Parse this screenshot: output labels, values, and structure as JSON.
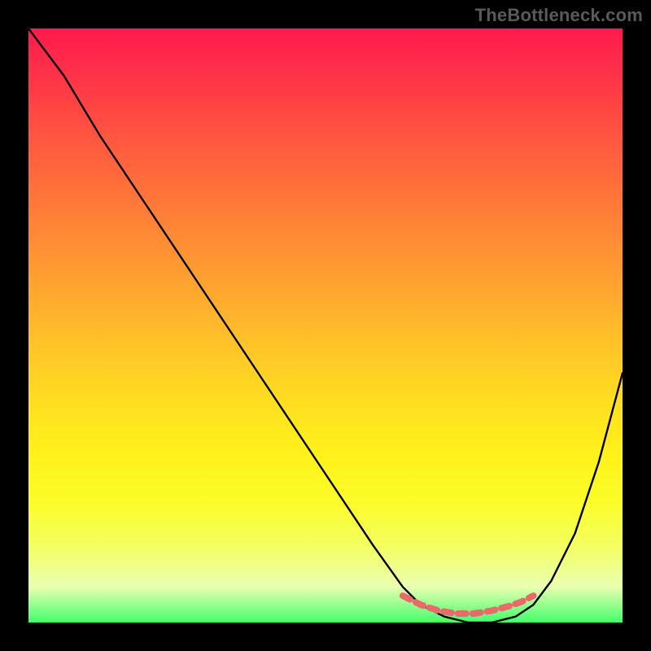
{
  "watermark": "TheBottleneck.com",
  "chart_data": {
    "type": "line",
    "title": "",
    "xlabel": "",
    "ylabel": "",
    "xlim": [
      0,
      100
    ],
    "ylim": [
      0,
      100
    ],
    "series": [
      {
        "name": "bottleneck-curve",
        "x": [
          0,
          6,
          12,
          20,
          30,
          40,
          50,
          58,
          63,
          66,
          70,
          74,
          78,
          82,
          85,
          88,
          92,
          96,
          100
        ],
        "values": [
          100,
          92,
          82,
          70,
          55,
          40,
          25,
          13,
          6,
          3,
          1,
          0,
          0,
          1,
          3,
          7,
          15,
          27,
          42
        ]
      },
      {
        "name": "optimal-red-band",
        "x": [
          63,
          66,
          69,
          72,
          75,
          78,
          81,
          83,
          85
        ],
        "values": [
          4.5,
          3.0,
          2.0,
          1.5,
          1.5,
          2.0,
          2.8,
          3.5,
          4.5
        ]
      }
    ],
    "colors": {
      "curve": "#000000",
      "highlight": "#e86a6a",
      "gradient_top": "#ff1a4d",
      "gradient_bottom": "#42ff6b"
    }
  }
}
